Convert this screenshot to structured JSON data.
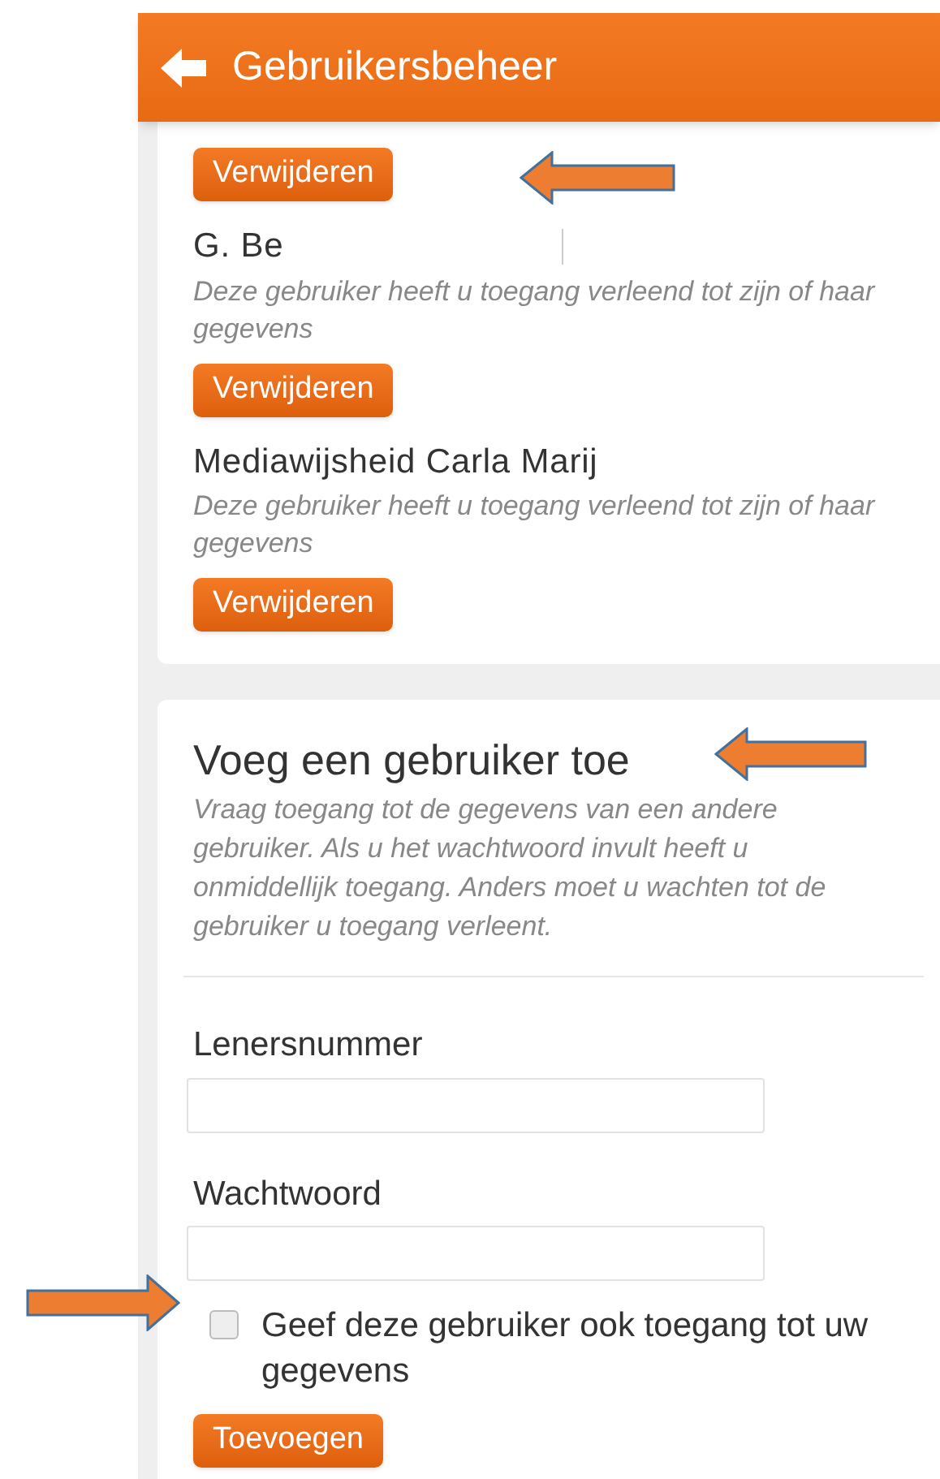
{
  "header": {
    "title": "Gebruikersbeheer"
  },
  "granted_users": [
    {
      "name": "G. Be",
      "redacted": true,
      "description": "Deze gebruiker heeft u toegang verleend tot zijn of haar gegevens",
      "button": "Verwijderen"
    },
    {
      "name": "Mediawijsheid Carla Marij",
      "redacted": false,
      "description": "Deze gebruiker heeft u toegang verleend tot zijn of haar gegevens",
      "button": "Verwijderen"
    }
  ],
  "top_button": "Verwijderen",
  "add_user": {
    "title": "Voeg een gebruiker toe",
    "description": "Vraag toegang tot de gegevens van een andere gebruiker. Als u het wachtwoord invult heeft u onmiddellijk toegang. Anders moet u wachten tot de gebruiker u toegang verleent.",
    "fields": [
      {
        "label": "Lenersnummer"
      },
      {
        "label": "Wachtwoord"
      }
    ],
    "checkbox": {
      "label": "Geef deze gebruiker ook toegang tot uw gegevens",
      "checked": false
    },
    "button": "Toevoegen"
  }
}
